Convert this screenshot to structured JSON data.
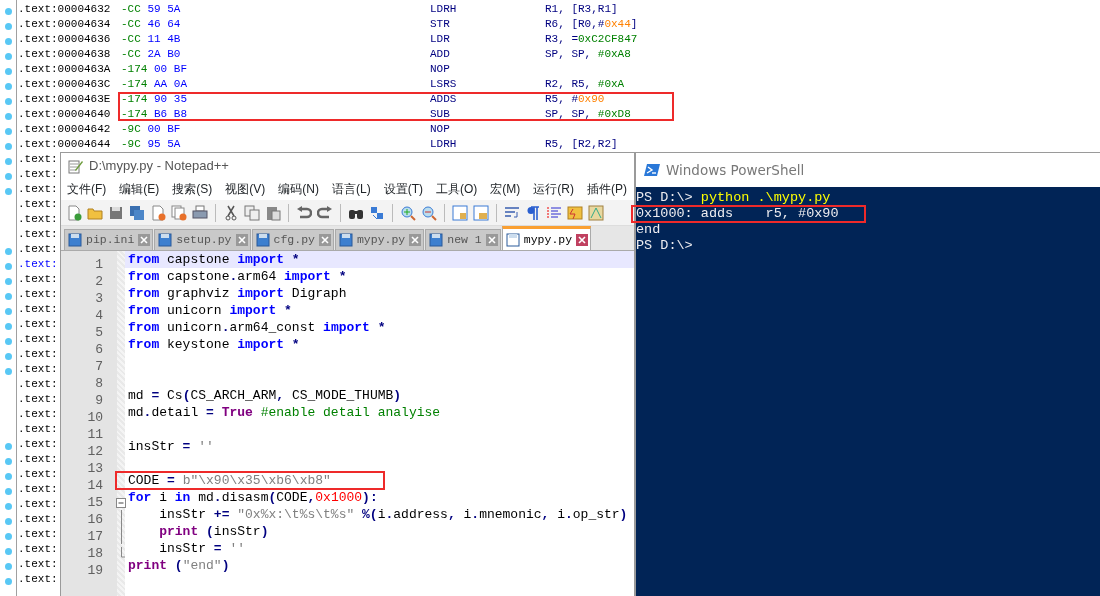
{
  "disassembly": {
    "rows": [
      {
        "address": ".text:00004632",
        "sp": "-CC",
        "bytes": "59 5A",
        "mnemonic": "LDRH",
        "operands": [
          {
            "text": "R1, [R3,R1]",
            "kind": "reg"
          }
        ],
        "dot": true,
        "current": false,
        "boxed": false
      },
      {
        "address": ".text:00004634",
        "sp": "-CC",
        "bytes": "46 64",
        "mnemonic": "STR",
        "operands": [
          {
            "text": "R6, [R0,#",
            "kind": "reg"
          },
          {
            "text": "0x44",
            "kind": "match"
          },
          {
            "text": "]",
            "kind": "reg"
          }
        ],
        "dot": true,
        "current": false,
        "boxed": false
      },
      {
        "address": ".text:00004636",
        "sp": "-CC",
        "bytes": "11 4B",
        "mnemonic": "LDR",
        "operands": [
          {
            "text": "R3, =",
            "kind": "reg"
          },
          {
            "text": "0xC2CF847",
            "kind": "imm"
          }
        ],
        "dot": true,
        "current": false,
        "boxed": false
      },
      {
        "address": ".text:00004638",
        "sp": "-CC",
        "bytes": "2A B0",
        "mnemonic": "ADD",
        "operands": [
          {
            "text": "SP, SP, ",
            "kind": "reg"
          },
          {
            "text": "#0xA8",
            "kind": "imm"
          }
        ],
        "dot": true,
        "current": false,
        "boxed": false
      },
      {
        "address": ".text:0000463A",
        "sp": "-174",
        "bytes": "00 BF",
        "mnemonic": "NOP",
        "dot": true,
        "current": false,
        "boxed": false
      },
      {
        "address": ".text:0000463C",
        "sp": "-174",
        "bytes": "AA 0A",
        "mnemonic": "LSRS",
        "operands": [
          {
            "text": "R2, R5, ",
            "kind": "reg"
          },
          {
            "text": "#0xA",
            "kind": "imm"
          }
        ],
        "dot": true,
        "current": false,
        "boxed": false
      },
      {
        "address": ".text:0000463E",
        "sp": "-174",
        "bytes": "90 35",
        "mnemonic": "ADDS",
        "operands": [
          {
            "text": "R5, #",
            "kind": "reg"
          },
          {
            "text": "0x90",
            "kind": "match"
          }
        ],
        "dot": true,
        "current": false,
        "boxed": true
      },
      {
        "address": ".text:00004640",
        "sp": "-174",
        "bytes": "B6 B8",
        "mnemonic": "SUB",
        "operands": [
          {
            "text": "SP, SP, ",
            "kind": "reg"
          },
          {
            "text": "#0xD8",
            "kind": "imm"
          }
        ],
        "dot": true,
        "current": false,
        "boxed": true
      },
      {
        "address": ".text:00004642",
        "sp": "-9C",
        "bytes": "00 BF",
        "mnemonic": "NOP",
        "dot": true,
        "current": false,
        "boxed": false
      },
      {
        "address": ".text:00004644",
        "sp": "-9C",
        "bytes": "95 5A",
        "mnemonic": "LDRH",
        "operands": [
          {
            "text": "R5, [R2,R2]",
            "kind": "reg"
          }
        ],
        "dot": true,
        "current": false,
        "boxed": false
      },
      {
        "address": ".text:",
        "dot": true,
        "current": false
      },
      {
        "address": ".text:",
        "dot": true,
        "current": false
      },
      {
        "address": ".text:",
        "dot": true,
        "current": false
      },
      {
        "address": ".text:",
        "dot": false,
        "current": false
      },
      {
        "address": ".text:",
        "dot": false,
        "current": false
      },
      {
        "address": ".text:",
        "dot": false,
        "current": false
      },
      {
        "address": ".text:",
        "dot": true,
        "current": false
      },
      {
        "address": ".text:",
        "dot": true,
        "current": true
      },
      {
        "address": ".text:",
        "dot": true,
        "current": false
      },
      {
        "address": ".text:",
        "dot": true,
        "current": false
      },
      {
        "address": ".text:",
        "dot": true,
        "current": false
      },
      {
        "address": ".text:",
        "dot": true,
        "current": false
      },
      {
        "address": ".text:",
        "dot": true,
        "current": false
      },
      {
        "address": ".text:",
        "dot": true,
        "current": false
      },
      {
        "address": ".text:",
        "dot": true,
        "current": false
      },
      {
        "address": ".text:",
        "dot": false,
        "current": false
      },
      {
        "address": ".text:",
        "dot": false,
        "current": false
      },
      {
        "address": ".text:",
        "dot": false,
        "current": false
      },
      {
        "address": ".text:",
        "dot": false,
        "current": false
      },
      {
        "address": ".text:",
        "dot": true,
        "current": false
      },
      {
        "address": ".text:",
        "dot": true,
        "current": false
      },
      {
        "address": ".text:",
        "dot": true,
        "current": false
      },
      {
        "address": ".text:",
        "dot": true,
        "current": false
      },
      {
        "address": ".text:",
        "dot": true,
        "current": false
      },
      {
        "address": ".text:",
        "dot": true,
        "current": false
      },
      {
        "address": ".text:",
        "dot": true,
        "current": false
      },
      {
        "address": ".text:",
        "dot": true,
        "current": false
      },
      {
        "address": ".text:",
        "dot": true,
        "current": false
      },
      {
        "address": ".text:",
        "dot": true,
        "current": false
      }
    ]
  },
  "notepad": {
    "title": "D:\\mypy.py - Notepad++",
    "menu": [
      "文件(F)",
      "编辑(E)",
      "搜索(S)",
      "视图(V)",
      "编码(N)",
      "语言(L)",
      "设置(T)",
      "工具(O)",
      "宏(M)",
      "运行(R)",
      "插件(P)"
    ],
    "tabs": [
      {
        "label": "pip.ini",
        "selected": false
      },
      {
        "label": "setup.py",
        "selected": false
      },
      {
        "label": "cfg.py",
        "selected": false
      },
      {
        "label": "mypy.py",
        "selected": false
      },
      {
        "label": "new 1",
        "selected": false
      },
      {
        "label": "mypy.py",
        "selected": true
      }
    ],
    "lines": [
      {
        "number": "1",
        "current": true,
        "boxed": false,
        "tokens": [
          {
            "text": "from",
            "kind": "kw"
          },
          {
            "text": " capstone ",
            "kind": "id"
          },
          {
            "text": "import",
            "kind": "kw"
          },
          {
            "text": " *",
            "kind": "op"
          }
        ]
      },
      {
        "number": "2",
        "current": false,
        "boxed": false,
        "tokens": [
          {
            "text": "from",
            "kind": "kw"
          },
          {
            "text": " capstone",
            "kind": "id"
          },
          {
            "text": ".",
            "kind": "op"
          },
          {
            "text": "arm64 ",
            "kind": "id"
          },
          {
            "text": "import",
            "kind": "kw"
          },
          {
            "text": " *",
            "kind": "op"
          }
        ]
      },
      {
        "number": "3",
        "current": false,
        "boxed": false,
        "tokens": [
          {
            "text": "from",
            "kind": "kw"
          },
          {
            "text": " graphviz ",
            "kind": "id"
          },
          {
            "text": "import",
            "kind": "kw"
          },
          {
            "text": " Digraph",
            "kind": "id"
          }
        ]
      },
      {
        "number": "4",
        "current": false,
        "boxed": false,
        "tokens": [
          {
            "text": "from",
            "kind": "kw"
          },
          {
            "text": " unicorn ",
            "kind": "id"
          },
          {
            "text": "import",
            "kind": "kw"
          },
          {
            "text": " *",
            "kind": "op"
          }
        ]
      },
      {
        "number": "5",
        "current": false,
        "boxed": false,
        "tokens": [
          {
            "text": "from",
            "kind": "kw"
          },
          {
            "text": " unicorn",
            "kind": "id"
          },
          {
            "text": ".",
            "kind": "op"
          },
          {
            "text": "arm64_const ",
            "kind": "id"
          },
          {
            "text": "import",
            "kind": "kw"
          },
          {
            "text": " *",
            "kind": "op"
          }
        ]
      },
      {
        "number": "6",
        "current": false,
        "boxed": false,
        "tokens": [
          {
            "text": "from",
            "kind": "kw"
          },
          {
            "text": " keystone ",
            "kind": "id"
          },
          {
            "text": "import",
            "kind": "kw"
          },
          {
            "text": " *",
            "kind": "op"
          }
        ]
      },
      {
        "number": "7",
        "current": false,
        "boxed": false
      },
      {
        "number": "8",
        "current": false,
        "boxed": false
      },
      {
        "number": "9",
        "current": false,
        "boxed": false,
        "tokens": [
          {
            "text": "md ",
            "kind": "id"
          },
          {
            "text": "=",
            "kind": "op"
          },
          {
            "text": " Cs",
            "kind": "id"
          },
          {
            "text": "(",
            "kind": "op"
          },
          {
            "text": "CS_ARCH_ARM",
            "kind": "id"
          },
          {
            "text": ",",
            "kind": "op"
          },
          {
            "text": " CS_MODE_THUMB",
            "kind": "id"
          },
          {
            "text": ")",
            "kind": "op"
          }
        ]
      },
      {
        "number": "10",
        "current": false,
        "boxed": false,
        "tokens": [
          {
            "text": "md",
            "kind": "id"
          },
          {
            "text": ".",
            "kind": "op"
          },
          {
            "text": "detail ",
            "kind": "id"
          },
          {
            "text": "=",
            "kind": "op"
          },
          {
            "text": " True",
            "kind": "builtin"
          },
          {
            "text": " #enable detail analyise",
            "kind": "comment"
          }
        ]
      },
      {
        "number": "11",
        "current": false,
        "boxed": false
      },
      {
        "number": "12",
        "current": false,
        "boxed": false,
        "tokens": [
          {
            "text": "insStr ",
            "kind": "id"
          },
          {
            "text": "=",
            "kind": "op"
          },
          {
            "text": " ''",
            "kind": "str"
          }
        ]
      },
      {
        "number": "13",
        "current": false,
        "boxed": false
      },
      {
        "number": "14",
        "current": false,
        "boxed": true,
        "tokens": [
          {
            "text": "CODE ",
            "kind": "id"
          },
          {
            "text": "=",
            "kind": "op"
          },
          {
            "text": " b\"\\x90\\x35\\xb6\\xb8\"",
            "kind": "str"
          }
        ]
      },
      {
        "number": "15",
        "current": false,
        "boxed": false,
        "tokens": [
          {
            "text": "for",
            "kind": "kw"
          },
          {
            "text": " i ",
            "kind": "id"
          },
          {
            "text": "in",
            "kind": "kw"
          },
          {
            "text": " md",
            "kind": "id"
          },
          {
            "text": ".",
            "kind": "op"
          },
          {
            "text": "disasm",
            "kind": "id"
          },
          {
            "text": "(",
            "kind": "op"
          },
          {
            "text": "CODE",
            "kind": "id"
          },
          {
            "text": ",",
            "kind": "op"
          },
          {
            "text": "0x1000",
            "kind": "num"
          },
          {
            "text": "):",
            "kind": "op"
          }
        ],
        "children": [
          {
            "number": "16",
            "current": false,
            "boxed": false,
            "tokens": [
              {
                "text": "    insStr ",
                "kind": "id"
              },
              {
                "text": "+=",
                "kind": "op"
              },
              {
                "text": " \"0x%x:\\t%s\\t%s\"",
                "kind": "str"
              },
              {
                "text": " %(",
                "kind": "op"
              },
              {
                "text": "i",
                "kind": "id"
              },
              {
                "text": ".",
                "kind": "op"
              },
              {
                "text": "address",
                "kind": "id"
              },
              {
                "text": ",",
                "kind": "op"
              },
              {
                "text": " i",
                "kind": "id"
              },
              {
                "text": ".",
                "kind": "op"
              },
              {
                "text": "mnemonic",
                "kind": "id"
              },
              {
                "text": ",",
                "kind": "op"
              },
              {
                "text": " i",
                "kind": "id"
              },
              {
                "text": ".",
                "kind": "op"
              },
              {
                "text": "op_str",
                "kind": "id"
              },
              {
                "text": ")",
                "kind": "op"
              }
            ]
          },
          {
            "number": "17",
            "current": false,
            "boxed": false,
            "tokens": [
              {
                "text": "    print",
                "kind": "builtin"
              },
              {
                "text": " (",
                "kind": "op"
              },
              {
                "text": "insStr",
                "kind": "id"
              },
              {
                "text": ")",
                "kind": "op"
              }
            ]
          },
          {
            "number": "18",
            "current": false,
            "boxed": false,
            "tokens": [
              {
                "text": "    insStr ",
                "kind": "id"
              },
              {
                "text": "=",
                "kind": "op"
              },
              {
                "text": " ''",
                "kind": "str"
              }
            ]
          }
        ]
      },
      {
        "number": "19",
        "current": false,
        "boxed": false,
        "tokens": [
          {
            "text": "print",
            "kind": "builtin"
          },
          {
            "text": " (",
            "kind": "op"
          },
          {
            "text": "\"end\"",
            "kind": "str"
          },
          {
            "text": ")",
            "kind": "op"
          }
        ]
      }
    ]
  },
  "powershell": {
    "title": "Windows PowerShell",
    "lines": [
      {
        "boxed": false,
        "segments": [
          {
            "text": "PS D:\\> ",
            "kind": "output"
          },
          {
            "text": "python .\\mypy.py",
            "kind": "command"
          }
        ]
      },
      {
        "boxed": true,
        "segments": [
          {
            "text": "0x1000: adds    r5, #0x90",
            "kind": "output"
          }
        ]
      },
      {
        "boxed": false,
        "segments": [
          {
            "text": "end",
            "kind": "output"
          }
        ]
      },
      {
        "boxed": false,
        "segments": [
          {
            "text": "PS D:\\>",
            "kind": "output"
          }
        ]
      }
    ]
  }
}
